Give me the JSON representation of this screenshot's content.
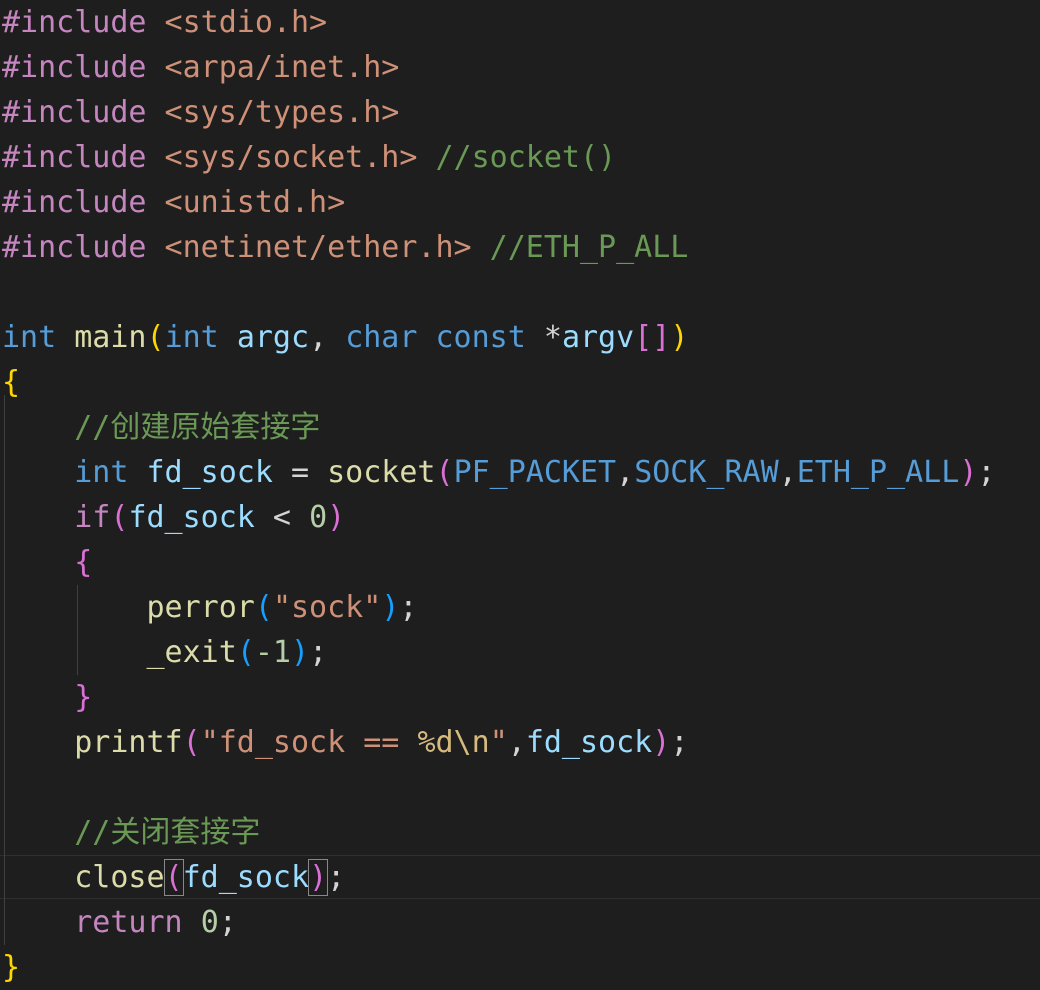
{
  "theme": {
    "background": "#1e1e1e",
    "colors": {
      "preprocessor": "#c586c0",
      "string": "#ce9178",
      "comment": "#6a9955",
      "keyword": "#569cd6",
      "control": "#c586c0",
      "function": "#dcdcaa",
      "variable": "#9cdcfe",
      "macro": "#569cd6",
      "number": "#b5cea8",
      "escape": "#d7ba7d",
      "operator": "#d4d4d4",
      "bracket_1": "#ffd700",
      "bracket_2": "#da70d6",
      "bracket_3": "#179fff"
    }
  },
  "code": {
    "lines": [
      [
        {
          "t": "#include",
          "c": "preprocessor"
        },
        {
          "t": " <stdio.h>",
          "c": "string"
        }
      ],
      [
        {
          "t": "#include",
          "c": "preprocessor"
        },
        {
          "t": " <arpa/inet.h>",
          "c": "string"
        }
      ],
      [
        {
          "t": "#include",
          "c": "preprocessor"
        },
        {
          "t": " <sys/types.h>",
          "c": "string"
        }
      ],
      [
        {
          "t": "#include",
          "c": "preprocessor"
        },
        {
          "t": " <sys/socket.h>",
          "c": "string"
        },
        {
          "t": " //socket()",
          "c": "comment"
        }
      ],
      [
        {
          "t": "#include",
          "c": "preprocessor"
        },
        {
          "t": " <unistd.h>",
          "c": "string"
        }
      ],
      [
        {
          "t": "#include",
          "c": "preprocessor"
        },
        {
          "t": " <netinet/ether.h>",
          "c": "string"
        },
        {
          "t": " //ETH_P_ALL",
          "c": "comment"
        }
      ],
      [],
      [
        {
          "t": "int",
          "c": "keyword"
        },
        {
          "t": " ",
          "c": "operator"
        },
        {
          "t": "main",
          "c": "function"
        },
        {
          "t": "(",
          "c": "bracket_1"
        },
        {
          "t": "int",
          "c": "keyword"
        },
        {
          "t": " ",
          "c": "operator"
        },
        {
          "t": "argc",
          "c": "variable"
        },
        {
          "t": ", ",
          "c": "operator"
        },
        {
          "t": "char",
          "c": "keyword"
        },
        {
          "t": " ",
          "c": "operator"
        },
        {
          "t": "const",
          "c": "keyword"
        },
        {
          "t": " *",
          "c": "operator"
        },
        {
          "t": "argv",
          "c": "variable"
        },
        {
          "t": "[]",
          "c": "bracket_2"
        },
        {
          "t": ")",
          "c": "bracket_1"
        }
      ],
      [
        {
          "t": "{",
          "c": "bracket_1"
        }
      ],
      [
        {
          "t": "    ",
          "c": "operator"
        },
        {
          "t": "//创建原始套接字",
          "c": "comment"
        }
      ],
      [
        {
          "t": "    ",
          "c": "operator"
        },
        {
          "t": "int",
          "c": "keyword"
        },
        {
          "t": " ",
          "c": "operator"
        },
        {
          "t": "fd_sock",
          "c": "variable"
        },
        {
          "t": " = ",
          "c": "operator"
        },
        {
          "t": "socket",
          "c": "function"
        },
        {
          "t": "(",
          "c": "bracket_2"
        },
        {
          "t": "PF_PACKET",
          "c": "macro"
        },
        {
          "t": ",",
          "c": "operator"
        },
        {
          "t": "SOCK_RAW",
          "c": "macro"
        },
        {
          "t": ",",
          "c": "operator"
        },
        {
          "t": "ETH_P_ALL",
          "c": "macro"
        },
        {
          "t": ")",
          "c": "bracket_2"
        },
        {
          "t": ";",
          "c": "operator"
        }
      ],
      [
        {
          "t": "    ",
          "c": "operator"
        },
        {
          "t": "if",
          "c": "control"
        },
        {
          "t": "(",
          "c": "bracket_2"
        },
        {
          "t": "fd_sock",
          "c": "variable"
        },
        {
          "t": " < ",
          "c": "operator"
        },
        {
          "t": "0",
          "c": "number"
        },
        {
          "t": ")",
          "c": "bracket_2"
        }
      ],
      [
        {
          "t": "    ",
          "c": "operator"
        },
        {
          "t": "{",
          "c": "bracket_2"
        }
      ],
      [
        {
          "t": "        ",
          "c": "operator"
        },
        {
          "t": "perror",
          "c": "function"
        },
        {
          "t": "(",
          "c": "bracket_3"
        },
        {
          "t": "\"sock\"",
          "c": "string"
        },
        {
          "t": ")",
          "c": "bracket_3"
        },
        {
          "t": ";",
          "c": "operator"
        }
      ],
      [
        {
          "t": "        ",
          "c": "operator"
        },
        {
          "t": "_exit",
          "c": "function"
        },
        {
          "t": "(",
          "c": "bracket_3"
        },
        {
          "t": "-1",
          "c": "number"
        },
        {
          "t": ")",
          "c": "bracket_3"
        },
        {
          "t": ";",
          "c": "operator"
        }
      ],
      [
        {
          "t": "    ",
          "c": "operator"
        },
        {
          "t": "}",
          "c": "bracket_2"
        }
      ],
      [
        {
          "t": "    ",
          "c": "operator"
        },
        {
          "t": "printf",
          "c": "function"
        },
        {
          "t": "(",
          "c": "bracket_2"
        },
        {
          "t": "\"fd_sock == ",
          "c": "string"
        },
        {
          "t": "%d\\n",
          "c": "escape"
        },
        {
          "t": "\"",
          "c": "string"
        },
        {
          "t": ",",
          "c": "operator"
        },
        {
          "t": "fd_sock",
          "c": "variable"
        },
        {
          "t": ")",
          "c": "bracket_2"
        },
        {
          "t": ";",
          "c": "operator"
        }
      ],
      [],
      [
        {
          "t": "    ",
          "c": "operator"
        },
        {
          "t": "//关闭套接字",
          "c": "comment"
        }
      ],
      [
        {
          "t": "    ",
          "c": "operator"
        },
        {
          "t": "close",
          "c": "function"
        },
        {
          "t": "(",
          "c": "bracket_2",
          "box": true
        },
        {
          "t": "fd_sock",
          "c": "variable"
        },
        {
          "t": ")",
          "c": "bracket_2",
          "box": true
        },
        {
          "t": ";",
          "c": "operator"
        }
      ],
      [
        {
          "t": "    ",
          "c": "operator"
        },
        {
          "t": "return",
          "c": "control"
        },
        {
          "t": " ",
          "c": "operator"
        },
        {
          "t": "0",
          "c": "number"
        },
        {
          "t": ";",
          "c": "operator"
        }
      ],
      [
        {
          "t": "}",
          "c": "bracket_1"
        }
      ]
    ]
  }
}
